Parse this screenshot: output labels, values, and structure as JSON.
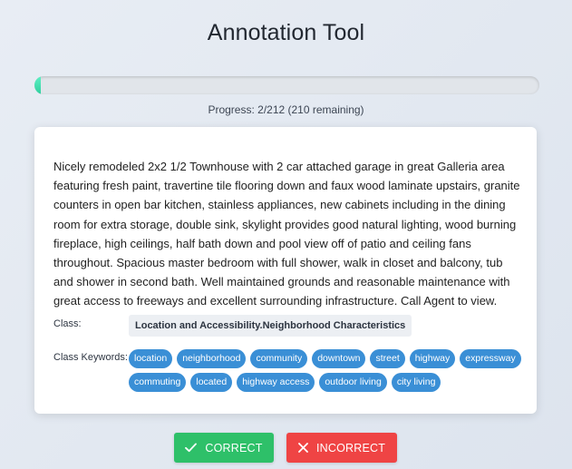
{
  "title": "Annotation Tool",
  "progress": {
    "current": 2,
    "total": 212,
    "fraction": 0.0094,
    "text": "Progress: 2/212 (210 remaining)",
    "fill_color": "#2fcf9e"
  },
  "item": {
    "description": "Nicely remodeled 2x2 1/2 Townhouse with 2 car attached garage in great Galleria area featuring fresh paint, travertine tile flooring down and faux wood laminate upstairs, granite counters in open bar kitchen, stainless appliances, new cabinets including in the dining room for extra storage, double sink, skylight provides good natural lighting, wood burning fireplace, high ceilings, half bath down and pool view off of patio and ceiling fans throughout. Spacious master bedroom with full shower, walk in closet and balcony, tub and shower in second bath. Well maintained grounds and reasonable maintenance with great access to freeways and excellent surrounding infrastructure. Call Agent to view.",
    "class_label": "Class:",
    "class_value": "Location and Accessibility.Neighborhood Characteristics",
    "keywords_label": "Class Keywords:",
    "keywords": [
      "location",
      "neighborhood",
      "community",
      "downtown",
      "street",
      "highway",
      "expressway",
      "commuting",
      "located",
      "highway access",
      "outdoor living",
      "city living"
    ],
    "keyword_color": "#3a8fd6"
  },
  "actions": {
    "correct_label": "CORRECT",
    "correct_icon": "check-icon",
    "correct_color": "#2ec069",
    "incorrect_label": "INCORRECT",
    "incorrect_icon": "x-icon",
    "incorrect_color": "#ef4444"
  }
}
